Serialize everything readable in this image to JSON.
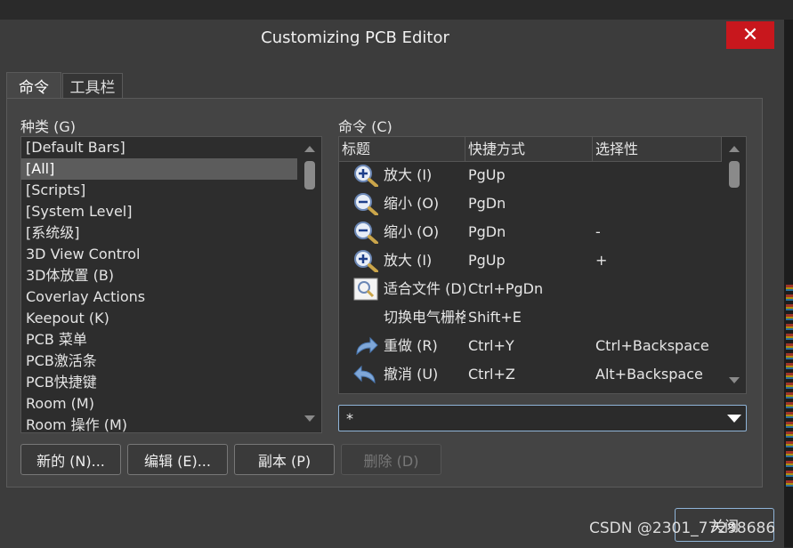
{
  "window": {
    "title": "Customizing PCB Editor",
    "close_glyph": "✕"
  },
  "tabs": [
    {
      "label": "命令"
    },
    {
      "label": "工具栏"
    }
  ],
  "categories": {
    "label": "种类 (G)",
    "items": [
      "[Default Bars]",
      "[All]",
      "[Scripts]",
      "[System Level]",
      "[系统级]",
      "3D View Control",
      "3D体放置 (B)",
      "Coverlay Actions",
      "Keepout (K)",
      "PCB 菜单",
      "PCB激活条",
      "PCB快捷键",
      "Room (M)",
      "Room 操作 (M)"
    ],
    "selected_index": 1
  },
  "commands": {
    "label": "命令 (C)",
    "columns": [
      "标题",
      "快捷方式",
      "选择性"
    ],
    "rows": [
      {
        "icon": "zoom-in-icon",
        "title": "放大 (I)",
        "shortcut": "PgUp",
        "alt": ""
      },
      {
        "icon": "zoom-out-icon",
        "title": "缩小 (O)",
        "shortcut": "PgDn",
        "alt": ""
      },
      {
        "icon": "zoom-out-icon",
        "title": "缩小 (O)",
        "shortcut": "PgDn",
        "alt": "-"
      },
      {
        "icon": "zoom-in-icon",
        "title": "放大 (I)",
        "shortcut": "PgUp",
        "alt": "+"
      },
      {
        "icon": "fit-document-icon",
        "title": "适合文件 (D)",
        "shortcut": "Ctrl+PgDn",
        "alt": ""
      },
      {
        "icon": "",
        "title": "切换电气栅格",
        "shortcut": "Shift+E",
        "alt": ""
      },
      {
        "icon": "redo-icon",
        "title": "重做 (R)",
        "shortcut": "Ctrl+Y",
        "alt": "Ctrl+Backspace"
      },
      {
        "icon": "undo-icon",
        "title": "撤消 (U)",
        "shortcut": "Ctrl+Z",
        "alt": "Alt+Backspace"
      }
    ]
  },
  "filter": {
    "value": "*"
  },
  "buttons": {
    "new": "新的 (N)...",
    "edit": "编辑 (E)...",
    "copy": "副本 (P)",
    "delete": "删除 (D)",
    "close": "关闭"
  },
  "watermark": "CSDN @2301_77298686"
}
